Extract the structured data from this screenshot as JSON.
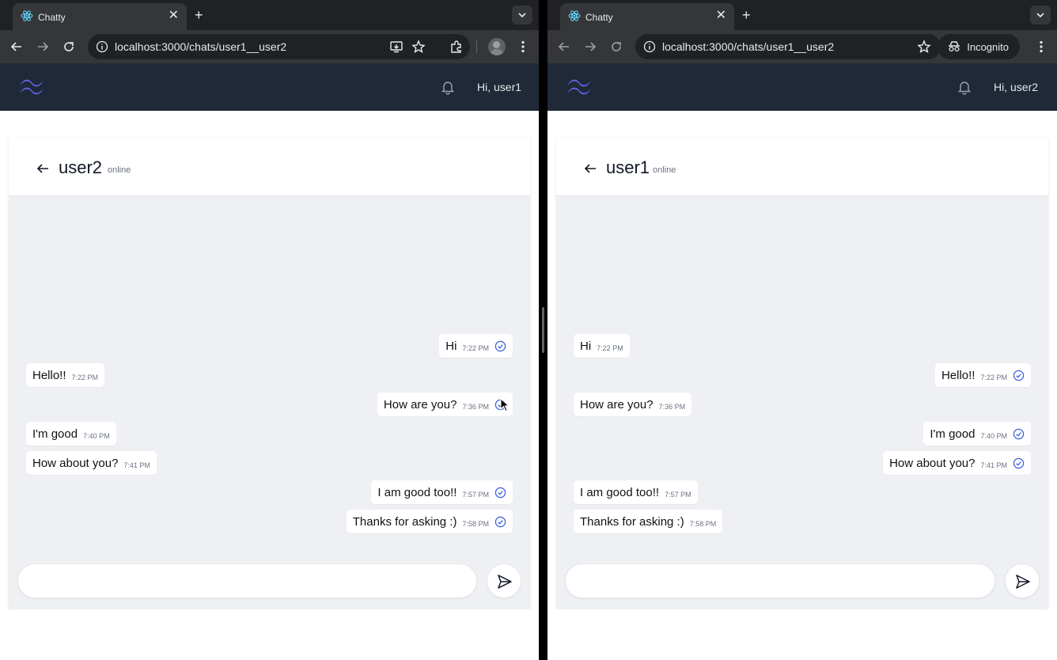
{
  "left_window": {
    "tab": {
      "title": "Chatty"
    },
    "address": "localhost:3000/chats/user1__user2",
    "navbar": {
      "greeting": "Hi, user1"
    },
    "chat": {
      "peer": "user2",
      "status": "online",
      "messages": [
        {
          "text": "Hi",
          "time": "7:22 PM",
          "direction": "out"
        },
        {
          "text": "Hello!!",
          "time": "7:22 PM",
          "direction": "in"
        },
        {
          "text": "How are you?",
          "time": "7:36 PM",
          "direction": "out"
        },
        {
          "text": "I'm good",
          "time": "7:40 PM",
          "direction": "in"
        },
        {
          "text": "How about you?",
          "time": "7:41 PM",
          "direction": "in"
        },
        {
          "text": "I am good too!!",
          "time": "7:57 PM",
          "direction": "out"
        },
        {
          "text": "Thanks for asking :)",
          "time": "7:58 PM",
          "direction": "out"
        }
      ]
    },
    "input": {
      "value": "",
      "placeholder": ""
    }
  },
  "right_window": {
    "tab": {
      "title": "Chatty"
    },
    "address": "localhost:3000/chats/user1__user2",
    "incognito_label": "Incognito",
    "navbar": {
      "greeting": "Hi, user2"
    },
    "chat": {
      "peer": "user1",
      "status": "online",
      "messages": [
        {
          "text": "Hi",
          "time": "7:22 PM",
          "direction": "in"
        },
        {
          "text": "Hello!!",
          "time": "7:22 PM",
          "direction": "out"
        },
        {
          "text": "How are you?",
          "time": "7:36 PM",
          "direction": "in"
        },
        {
          "text": "I'm good",
          "time": "7:40 PM",
          "direction": "out"
        },
        {
          "text": "How about you?",
          "time": "7:41 PM",
          "direction": "out"
        },
        {
          "text": "I am good too!!",
          "time": "7:57 PM",
          "direction": "in"
        },
        {
          "text": "Thanks for asking :)",
          "time": "7:58 PM",
          "direction": "in"
        }
      ]
    },
    "input": {
      "value": "",
      "placeholder": ""
    }
  },
  "colors": {
    "navbar_bg": "#1f2937",
    "logo": "#6366f1",
    "read_check": "#3b5bdb",
    "chat_bg": "#eef0f3",
    "browser_frame": "#35363a"
  },
  "icons": [
    "react-favicon-icon",
    "close-icon",
    "plus-icon",
    "chevron-down-icon",
    "back-arrow-icon",
    "forward-arrow-icon",
    "reload-icon",
    "info-icon",
    "install-app-icon",
    "star-icon",
    "extensions-icon",
    "profile-avatar-icon",
    "more-vert-icon",
    "incognito-icon",
    "tailwind-logo-icon",
    "bell-icon",
    "arrow-left-icon",
    "read-check-icon",
    "send-icon"
  ]
}
